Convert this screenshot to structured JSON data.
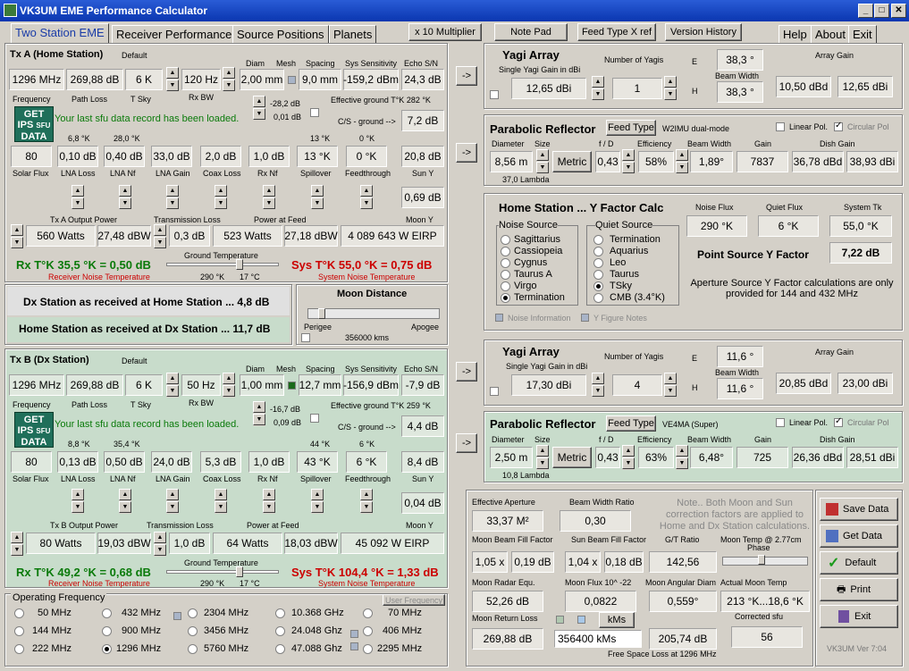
{
  "window": {
    "title": "VK3UM EME Performance Calculator"
  },
  "tabs": [
    "Two Station EME",
    "Receiver Performance",
    "Source Positions",
    "Planets"
  ],
  "top_buttons": {
    "mult": "x 10 Multiplier",
    "notepad": "Note Pad",
    "feedtype": "Feed Type X ref",
    "history": "Version History"
  },
  "menu_tabs": [
    "Help",
    "About",
    "Exit"
  ],
  "txa": {
    "title": "Tx A (Home Station)",
    "default": "Default",
    "row1": [
      "1296 MHz",
      "269,88 dB",
      "6 K",
      "120 Hz",
      "2,00 mm",
      "9,0 mm",
      "-159,2 dBm",
      "24,3 dB"
    ],
    "hdr1": [
      "Diam",
      "Mesh",
      "Spacing",
      "Sys Sensitivity",
      "Echo S/N"
    ],
    "lbl1": [
      "Frequency",
      "Path Loss",
      "T Sky",
      "Rx BW"
    ],
    "mesh1": "-28,2 dB",
    "mesh2": "0,01 dB",
    "effground": "Effective ground T°K 282 °K",
    "cs": "C/S - ground -->",
    "cs_val": "7,2 dB",
    "msg": "Your last sfu data record has been loaded.",
    "tops": [
      "6,8 °K",
      "28,0 °K",
      "13 °K",
      "0 °K"
    ],
    "row2": [
      "80",
      "0,10 dB",
      "0,40 dB",
      "33,0 dB",
      "2,0 dB",
      "1,0 dB",
      "13 °K",
      "0 °K",
      "20,8 dB"
    ],
    "lbl2": [
      "Solar Flux",
      "LNA Loss",
      "LNA Nf",
      "LNA Gain",
      "Coax Loss",
      "Rx Nf",
      "Spillover",
      "Feedthrough",
      "Sun Y"
    ],
    "suny": "0,69 dB",
    "lbl3": [
      "Tx A Output Power",
      "Transmission Loss",
      "Power at Feed",
      "Moon Y"
    ],
    "row3": [
      "560 Watts",
      "27,48 dBW",
      "0,3 dB",
      "523 Watts",
      "27,18 dBW",
      "4 089 643 W EIRP"
    ],
    "rx": "Rx T°K 35,5 °K = 0,50 dB",
    "rxsub": "Receiver Noise Temperature",
    "ground": "Ground Temperature",
    "g1": "290 °K",
    "g2": "17 °C",
    "sys": "Sys T°K 55,0 °K = 0,75 dB",
    "syssub": "System Noise Temperature"
  },
  "mid": {
    "dx": "Dx Station as received at Home Station ... 4,8 dB",
    "home": "Home Station as received at Dx Station ... 11,7 dB",
    "moon_title": "Moon Distance",
    "perigee": "Perigee",
    "apogee": "Apogee",
    "kms": "356000 kms"
  },
  "txb": {
    "title": "Tx B (Dx Station)",
    "default": "Default",
    "row1": [
      "1296 MHz",
      "269,88 dB",
      "6 K",
      "50 Hz",
      "1,00 mm",
      "12,7 mm",
      "-156,9 dBm",
      "-7,9 dB"
    ],
    "mesh1": "-16,7 dB",
    "mesh2": "0,09 dB",
    "effground": "Effective ground T°K 259 °K",
    "cs_val": "4,4 dB",
    "tops": [
      "8,8 °K",
      "35,4 °K",
      "44 °K",
      "6 °K"
    ],
    "row2": [
      "80",
      "0,13 dB",
      "0,50 dB",
      "24,0 dB",
      "5,3 dB",
      "1,0 dB",
      "43 °K",
      "6 °K",
      "8,4 dB"
    ],
    "suny": "0,04 dB",
    "lbl3": [
      "Tx B Output Power",
      "Transmission Loss",
      "Power at Feed",
      "Moon Y"
    ],
    "row3": [
      "80 Watts",
      "19,03 dBW",
      "1,0 dB",
      "64 Watts",
      "18,03 dBW",
      "45 092 W EIRP"
    ],
    "rx": "Rx T°K 49,2 °K = 0,68 dB",
    "sys": "Sys T°K 104,4 °K = 1,33 dB",
    "g1": "290 °K",
    "g2": "17 °C"
  },
  "freq": {
    "title": "Operating Frequency",
    "user": "User Frequency",
    "options": [
      "50 MHz",
      "432 MHz",
      "2304 MHz",
      "10.368 GHz",
      "70 MHz",
      "144 MHz",
      "900 MHz",
      "3456 MHz",
      "24.048 Ghz",
      "406 MHz",
      "222 MHz",
      "1296 MHz",
      "5760 MHz",
      "47.088 Ghz",
      "2295 MHz"
    ]
  },
  "yagiA": {
    "title": "Yagi Array",
    "sub": "Single Yagi Gain in dBi",
    "n_lbl": "Number of Yagis",
    "e": "E",
    "h": "H",
    "e_val": "38,3 °",
    "bw": "Beam Width",
    "h_val": "38,3 °",
    "ag": "Array Gain",
    "gain": "12,65 dBi",
    "n": "1",
    "dbd": "10,50 dBd",
    "dbi": "12,65 dBi"
  },
  "paraA": {
    "title": "Parabolic Reflector",
    "feedbtn": "Feed Type",
    "feed": "W2IMU dual-mode",
    "linear": "Linear Pol.",
    "circ": "Circular Pol",
    "hdr": [
      "Diameter",
      "Size",
      "f / D",
      "Efficiency",
      "Beam Width",
      "Gain",
      "Dish Gain"
    ],
    "vals": [
      "8,56 m",
      "Metric",
      "0,43",
      "58%",
      "1,89°",
      "7837",
      "36,78 dBd",
      "38,93 dBi"
    ],
    "lambda": "37,0 Lambda"
  },
  "yfac": {
    "title": "Home Station ... Y Factor Calc",
    "noise": "Noise Source",
    "quiet": "Quiet Source",
    "nsrc": [
      "Sagittarius",
      "Cassiopeia",
      "Cygnus",
      "Taurus A",
      "Virgo",
      "Termination"
    ],
    "qsrc": [
      "Termination",
      "Aquarius",
      "Leo",
      "Taurus",
      "TSky",
      "CMB (3.4°K)"
    ],
    "h": [
      "Noise Flux",
      "Quiet Flux",
      "System Tk"
    ],
    "v": [
      "290 °K",
      "6 °K",
      "55,0 °K"
    ],
    "pt": "Point Source Y Factor",
    "pt_val": "7,22 dB",
    "note": "Aperture Source  Y Factor calculations are only provided for 144 and 432 MHz",
    "ni": "Noise Information",
    "yf": "Y Figure Notes"
  },
  "yagiB": {
    "title": "Yagi Array",
    "sub": "Single Yagi Gain in dBi",
    "n_lbl": "Number of Yagis",
    "e_val": "11,6 °",
    "h_val": "11,6 °",
    "gain": "17,30 dBi",
    "n": "4",
    "dbd": "20,85 dBd",
    "dbi": "23,00 dBi"
  },
  "paraB": {
    "feed": "VE4MA (Super)",
    "vals": [
      "2,50 m",
      "Metric",
      "0,43",
      "63%",
      "6,48°",
      "725",
      "26,36 dBd",
      "28,51 dBi"
    ],
    "lambda": "10,8 Lambda"
  },
  "bottom": {
    "ea": "Effective Aperture",
    "ea_v": "33,37 M²",
    "bwr": "Beam Width Ratio",
    "bwr_v": "0,30",
    "note": "Note.. Both Moon and Sun correction factors are applied to Home and Dx Station calculations.",
    "mbff": "Moon Beam Fill Factor",
    "mb1": "1,05 x",
    "mb2": "0,19 dB",
    "sbff": "Sun Beam Fill Factor",
    "sb1": "1,04 x",
    "sb2": "0,18 dB",
    "gt": "G/T Ratio",
    "gt_v": "142,56",
    "mt": "Moon Temp @ 2.77cm",
    "phase": "Phase",
    "mre": "Moon Radar Equ.",
    "mre_v": "52,26 dB",
    "mf": "Moon Flux 10^ -22",
    "mf_v": "0,0822",
    "mad": "Moon Angular Diam",
    "mad_v": "0,559°",
    "amt": "Actual Moon Temp",
    "amt_v": "213 °K...18,6 °K",
    "mrl": "Moon Return Loss",
    "mrl_v": "269,88 dB",
    "kms": "kMs",
    "dist": "356400 kMs",
    "fsl_v": "205,74 dB",
    "csfu": "Corrected sfu",
    "csfu_v": "56",
    "fsl": "Free Space Loss at 1296 MHz"
  },
  "actions": [
    "Save Data",
    "Get Data",
    "Default",
    "Print",
    "Exit"
  ],
  "version": "VK3UM Ver 7:04"
}
